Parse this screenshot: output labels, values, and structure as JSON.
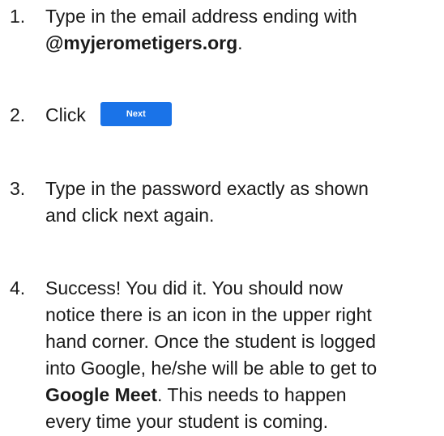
{
  "steps": [
    {
      "number": "1.",
      "line1": "Type in the email address ending with",
      "bold": "@myjerometigers.org",
      "after_bold": "."
    },
    {
      "number": "2.",
      "text": "Click",
      "button_label": "Next",
      "button_color": "#1a73e8"
    },
    {
      "number": "3.",
      "line1": "Type in the password exactly as shown",
      "line2": "and click next again."
    },
    {
      "number": "4.",
      "line1": "Success! You did it. You should now",
      "line2": "notice there is an icon in the upper right",
      "line3": "hand corner. Once the student is logged",
      "line4": "into Google, he/she will be able to get to",
      "bold": "Google Meet",
      "after_bold": ". This needs to happen",
      "line6": "every time your student is coming."
    }
  ]
}
